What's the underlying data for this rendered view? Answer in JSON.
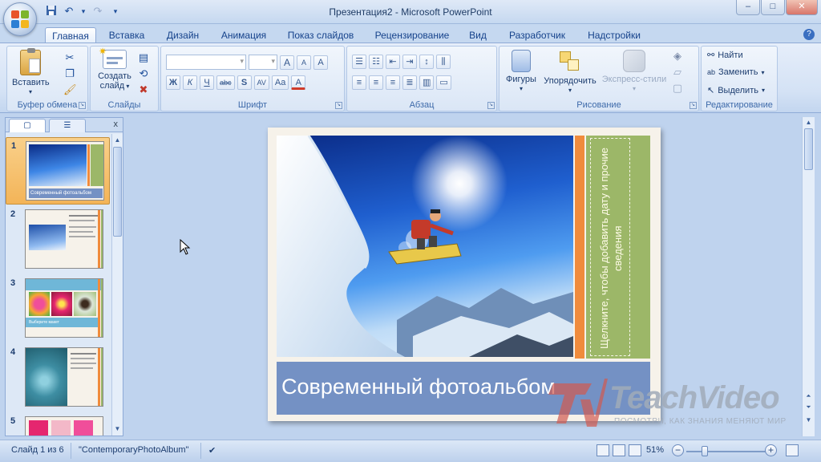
{
  "window": {
    "title": "Презентация2 - Microsoft PowerPoint",
    "buttons": {
      "minimize": "–",
      "maximize": "□",
      "close": "✕"
    }
  },
  "qat": {
    "save_icon": "save-icon",
    "undo_icon": "undo-icon",
    "redo_icon": "redo-icon",
    "customize_icon": "chevron-down-icon"
  },
  "tabs": [
    "Главная",
    "Вставка",
    "Дизайн",
    "Анимация",
    "Показ слайдов",
    "Рецензирование",
    "Вид",
    "Разработчик",
    "Надстройки"
  ],
  "help_label": "?",
  "ribbon": {
    "clipboard": {
      "label": "Буфер обмена",
      "paste": "Вставить"
    },
    "slides": {
      "label": "Слайды",
      "new_slide_line1": "Создать",
      "new_slide_line2": "слайд"
    },
    "font": {
      "label": "Шрифт",
      "font_name": "",
      "font_size": "",
      "bold": "Ж",
      "italic": "К",
      "underline": "Ч",
      "strike": "abc",
      "shadow": "S",
      "spacing": "AV",
      "case": "Aa",
      "grow": "A",
      "shrink": "A",
      "clear": "A",
      "color": "A"
    },
    "paragraph": {
      "label": "Абзац"
    },
    "drawing": {
      "label": "Рисование",
      "shapes": "Фигуры",
      "arrange": "Упорядочить",
      "quick_styles": "Экспресс-стили"
    },
    "editing": {
      "label": "Редактирование",
      "find": "Найти",
      "replace": "Заменить",
      "select": "Выделить"
    }
  },
  "slides_pane": {
    "tab_slides_icon": "slide-icon",
    "tab_outline_icon": "outline-icon",
    "close": "x",
    "thumbnails": [
      {
        "number": "1",
        "caption": "Современный фотоальбом"
      },
      {
        "number": "2"
      },
      {
        "number": "3",
        "caption": "Выберите макет"
      },
      {
        "number": "4"
      },
      {
        "number": "5"
      }
    ]
  },
  "slide": {
    "title": "Современный фотоальбом",
    "side_text": "Щелкните, чтобы добавить дату и прочие сведения",
    "colors": {
      "orange": "#f08b3c",
      "green": "#9cb768",
      "title_bg": "#7491c4"
    }
  },
  "watermark": {
    "brand": "TeachVideo",
    "tagline": "ПОСМОТРИ, КАК ЗНАНИЯ МЕНЯЮТ МИР"
  },
  "status": {
    "slide_of": "Слайд 1 из 6",
    "theme": "\"ContemporaryPhotoAlbum\"",
    "zoom": "51%",
    "zoom_level": 0.51
  }
}
